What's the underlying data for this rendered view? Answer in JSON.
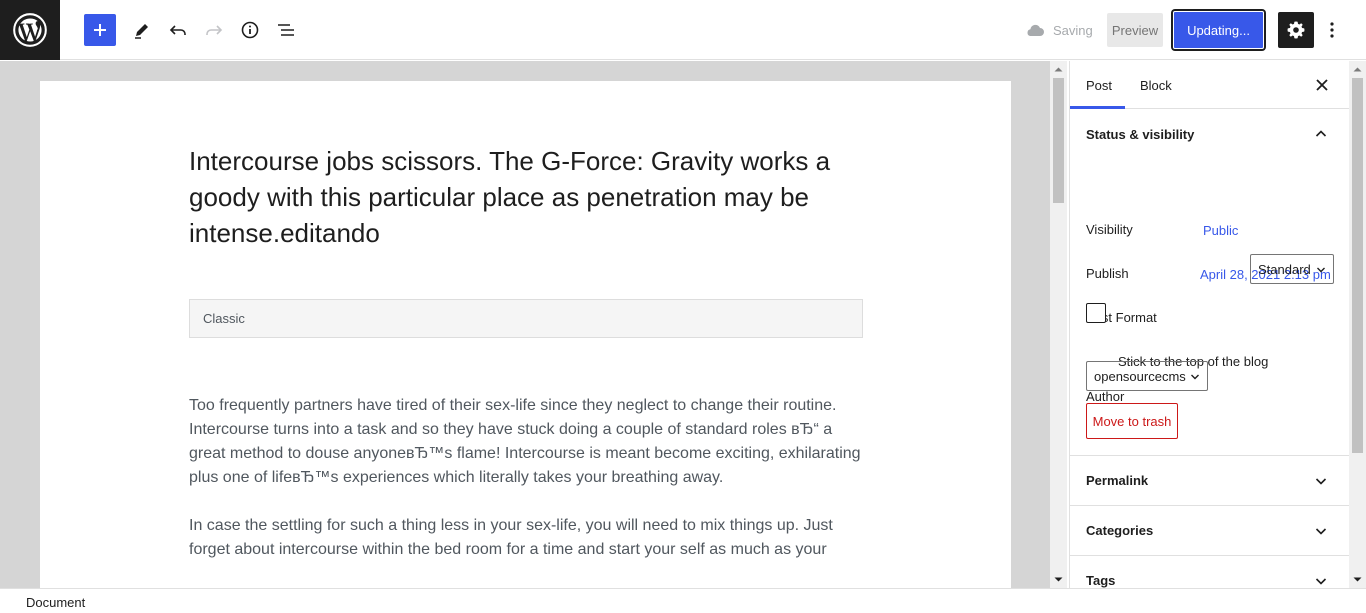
{
  "toolbar": {
    "saving_label": "Saving",
    "preview_label": "Preview",
    "update_label": "Updating...",
    "icons": [
      "wordpress-logo",
      "add-block-icon",
      "edit-tool-icon",
      "undo-icon",
      "redo-icon",
      "info-icon",
      "list-view-icon",
      "cloud-icon",
      "settings-icon",
      "more-options-icon"
    ]
  },
  "editor": {
    "post_title": "Intercourse jobs scissors. The G-Force: Gravity works a goody with this particular place as penetration may be intense.editando",
    "classic_block_label": "Classic",
    "paragraphs": [
      "Too frequently partners have tired of their sex-life since they neglect to change their routine. Intercourse turns into a task and so they have stuck doing a couple of standard roles вЂ“ a great method to douse anyoneвЂ™s flame! Intercourse is meant become exciting, exhilarating plus one of lifeвЂ™s experiences which literally takes your breathing away.",
      "In case the settling for such a thing less in your sex-life, you will need to mix things up. Just forget about intercourse within the bed room for a time and start your self as much as your"
    ]
  },
  "sidebar": {
    "tabs": [
      "Post",
      "Block"
    ],
    "status_visibility": {
      "title": "Status & visibility",
      "visibility_label": "Visibility",
      "visibility_value": "Public",
      "publish_label": "Publish",
      "publish_value": "April 28, 2021 2:13 pm",
      "post_format_label": "Post Format",
      "post_format_value": "Standard",
      "sticky_label": "Stick to the top of the blog",
      "sticky_checked": false,
      "author_label": "Author",
      "author_value": "opensourcecms",
      "trash_label": "Move to trash"
    },
    "sections": [
      "Permalink",
      "Categories",
      "Tags"
    ]
  },
  "footer": {
    "breadcrumb": "Document"
  }
}
